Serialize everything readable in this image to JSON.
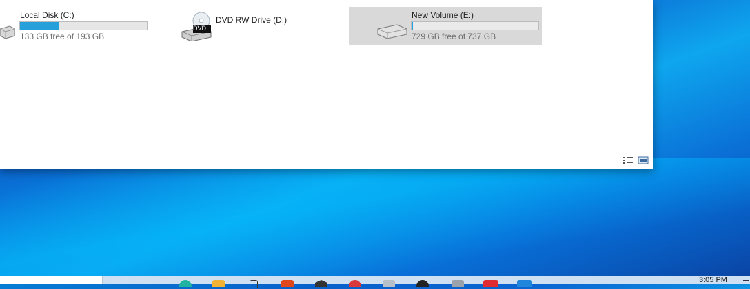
{
  "drives": [
    {
      "name": "Local Disk (C:)",
      "free_text": "133 GB free of 193 GB",
      "used_fraction": 0.31,
      "icon": "hard-drive-icon"
    },
    {
      "name": "DVD RW Drive (D:)",
      "icon": "dvd-drive-icon",
      "badge": "DVD"
    },
    {
      "name": "New Volume (E:)",
      "free_text": "729 GB free of 737 GB",
      "used_fraction": 0.011,
      "icon": "hard-drive-icon",
      "selected": true
    }
  ],
  "statusbar": {
    "details_view_icon": "details-view-icon",
    "large_icons_view_icon": "large-icons-view-icon"
  },
  "taskbar": {
    "clock_time": "3:05 PM",
    "pinned_icons": [
      "edge-icon",
      "file-explorer-icon",
      "pin-app-icon",
      "office-icon",
      "app-icon-dark",
      "red-circle-app-icon",
      "xbox-icon",
      "dark-app-icon",
      "gray-app-icon",
      "red-app-icon",
      "blue-app-icon"
    ]
  },
  "colors": {
    "progress_fill": "#26a0da",
    "selected_bg": "#d9d9d9",
    "taskbar_bg": "#cfe0f2"
  }
}
